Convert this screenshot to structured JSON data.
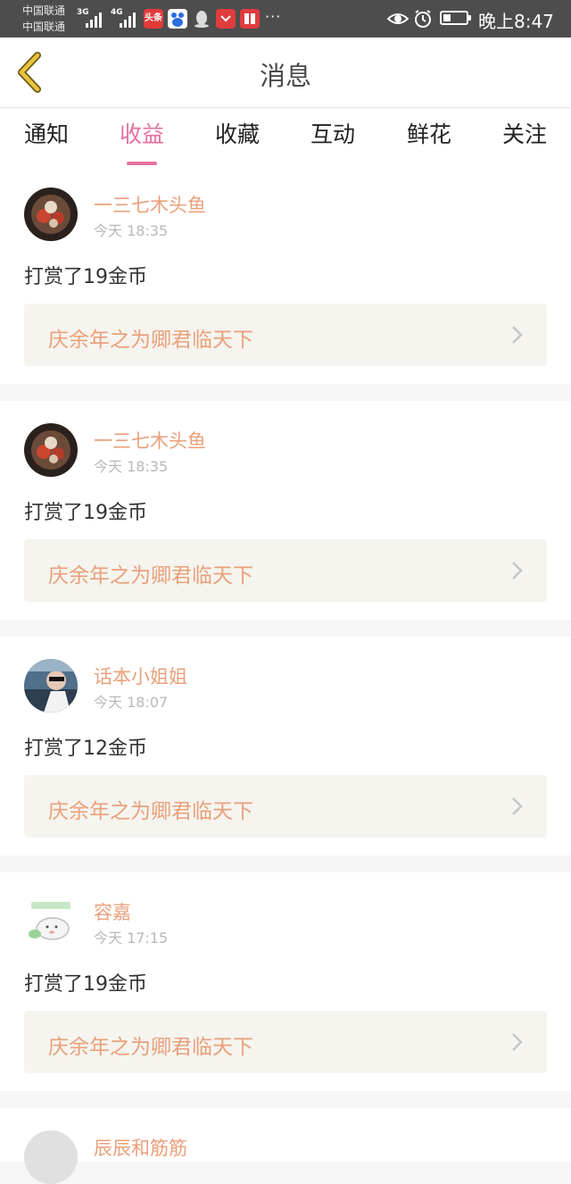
{
  "status_bar": {
    "carrier_1": "中国联通",
    "carrier_2": "中国联通",
    "net_1": "3G",
    "net_2": "4G",
    "app_icons": [
      "toutiao-icon",
      "baidu-icon",
      "qq-icon",
      "huawei-icon",
      "reader-icon"
    ],
    "more": "···",
    "time": "晚上8:47",
    "battery_level": 0.35
  },
  "header": {
    "title": "消息"
  },
  "tabs": {
    "active_index": 1,
    "items": [
      {
        "label": "通知"
      },
      {
        "label": "收益"
      },
      {
        "label": "收藏"
      },
      {
        "label": "互动"
      },
      {
        "label": "鲜花"
      },
      {
        "label": "关注"
      }
    ]
  },
  "messages": [
    {
      "user": "一三七木头鱼",
      "time": "今天 18:35",
      "action": "打赏了19金币",
      "book": "庆余年之为卿君临天下",
      "avatar": "fish-avatar"
    },
    {
      "user": "一三七木头鱼",
      "time": "今天 18:35",
      "action": "打赏了19金币",
      "book": "庆余年之为卿君临天下",
      "avatar": "fish-avatar"
    },
    {
      "user": "话本小姐姐",
      "time": "今天 18:07",
      "action": "打赏了12金币",
      "book": "庆余年之为卿君临天下",
      "avatar": "car-avatar"
    },
    {
      "user": "容嘉",
      "time": "今天 17:15",
      "action": "打赏了19金币",
      "book": "庆余年之为卿君临天下",
      "avatar": "sheep-avatar"
    }
  ],
  "partial_message": {
    "user": "辰辰和筋筋"
  },
  "colors": {
    "accent": "#e56fa0",
    "name": "#eaa07b",
    "back_arrow": "#e9c33a",
    "status_bar": "#4d4d4d"
  }
}
